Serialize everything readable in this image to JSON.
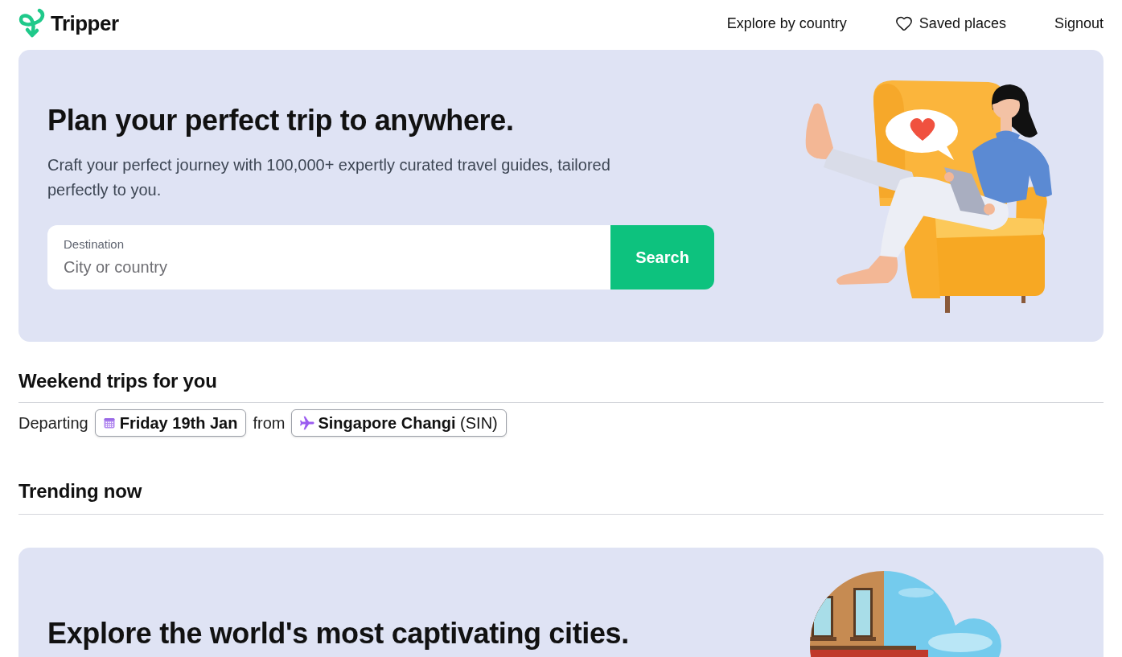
{
  "header": {
    "brand": "Tripper",
    "nav": [
      {
        "kind": "link",
        "label": "Explore by country"
      },
      {
        "kind": "icon_link",
        "label": "Saved places"
      },
      {
        "kind": "link",
        "label": "Signout"
      }
    ]
  },
  "hero": {
    "title": "Plan your perfect trip to anywhere.",
    "subtitle": "Craft your perfect journey with 100,000+ expertly curated travel guides, tailored perfectly to you.",
    "search": {
      "label": "Destination",
      "placeholder": "City or country",
      "button": "Search"
    }
  },
  "weekend_trips": {
    "title": "Weekend trips for you",
    "departing_label": "Departing",
    "date": "Friday 19th Jan",
    "from_label": "from",
    "airport": "**Singapore Changi** (SIN)"
  },
  "trending": {
    "title": "Trending now"
  },
  "promo": {
    "title": "Explore the world's most captivating cities."
  }
}
